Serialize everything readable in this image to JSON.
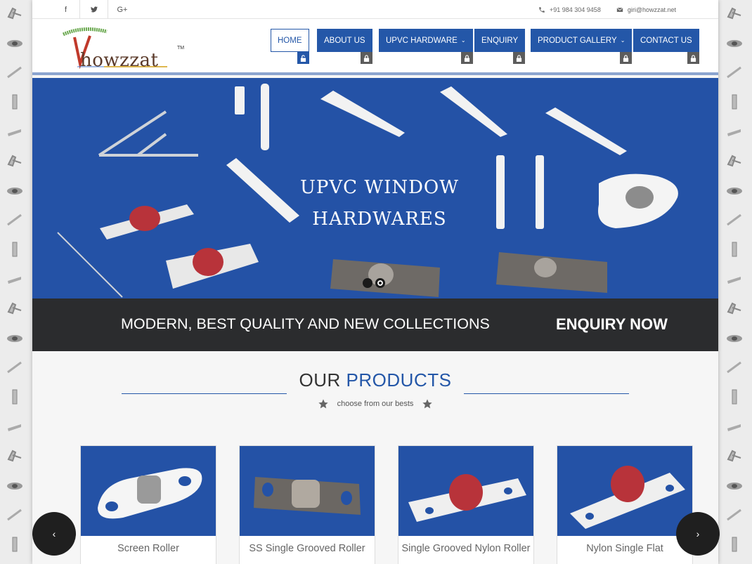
{
  "topbar": {
    "social": [
      {
        "icon": "facebook-icon",
        "glyph": "f"
      },
      {
        "icon": "twitter-icon",
        "glyph": "🐦"
      },
      {
        "icon": "google-plus-icon",
        "glyph": "G+"
      }
    ],
    "phone": "+91 984 304 9458",
    "email": "giri@howzzat.net"
  },
  "logo": {
    "text": "howzzat",
    "tm": "TM"
  },
  "nav": [
    {
      "label": "HOME",
      "active": true,
      "caret": ""
    },
    {
      "label": "ABOUT US",
      "active": false,
      "caret": ""
    },
    {
      "label": "UPVC HARDWARE",
      "active": false,
      "caret": "⌄"
    },
    {
      "label": "ENQUIRY",
      "active": false,
      "caret": ""
    },
    {
      "label": "PRODUCT GALLERY",
      "active": false,
      "caret": "⌄"
    },
    {
      "label": "CONTACT US",
      "active": false,
      "caret": ""
    }
  ],
  "banner": {
    "title_line1": "UPVC WINDOW",
    "title_line2": "HARDWARES",
    "slides_total": 2,
    "slide_active": 2
  },
  "strip": {
    "text": "MODERN, BEST QUALITY AND NEW COLLECTIONS",
    "cta": "ENQUIRY NOW"
  },
  "products": {
    "title_a": "OUR ",
    "title_b": "PRODUCTS",
    "subtitle": "choose from our bests",
    "items": [
      {
        "label": "Screen Roller"
      },
      {
        "label": "SS Single Grooved Roller"
      },
      {
        "label": "Single Grooved Nylon Roller"
      },
      {
        "label": "Nylon Single Flat"
      }
    ],
    "prev": "‹",
    "next": "›"
  },
  "colors": {
    "brand": "#2457a8",
    "banner": "#2452a6",
    "dark": "#2b2c2e"
  }
}
